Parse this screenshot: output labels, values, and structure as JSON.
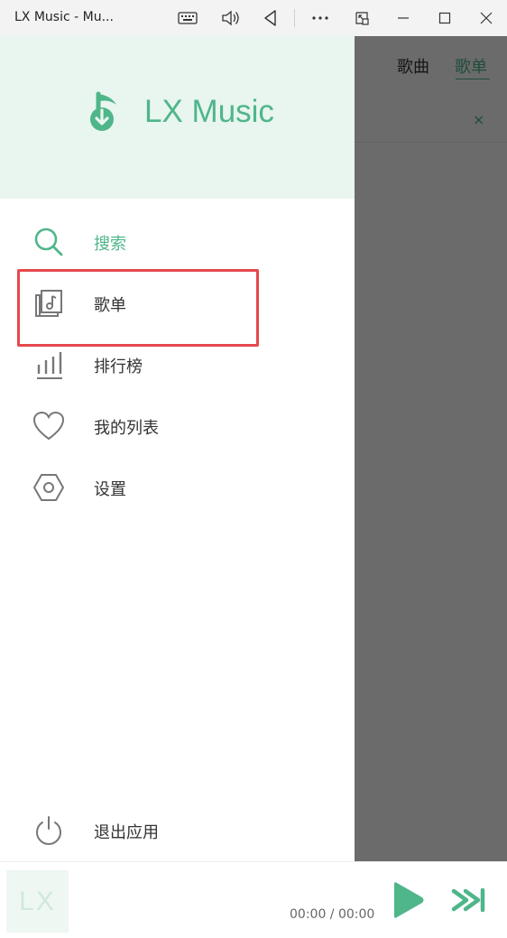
{
  "window": {
    "title": "LX Music - Mu...",
    "controls": [
      "keyboard-icon",
      "volume-icon",
      "back-icon",
      "more-icon",
      "compact-overlay-icon",
      "minimize-icon",
      "maximize-icon",
      "close-icon"
    ]
  },
  "background_app": {
    "tabs": [
      {
        "label": "歌曲"
      },
      {
        "label": "歌单"
      }
    ],
    "active_tab": "歌单",
    "close_label": "×"
  },
  "drawer": {
    "brand": "LX Music",
    "items": [
      {
        "label": "搜索",
        "icon": "search-icon",
        "active": true
      },
      {
        "label": "歌单",
        "icon": "playlist-icon",
        "active": false,
        "highlighted": true
      },
      {
        "label": "排行榜",
        "icon": "chart-bars-icon",
        "active": false
      },
      {
        "label": "我的列表",
        "icon": "heart-icon",
        "active": false
      },
      {
        "label": "设置",
        "icon": "hexagon-settings-icon",
        "active": false
      }
    ],
    "exit": {
      "label": "退出应用",
      "icon": "power-icon"
    }
  },
  "player": {
    "cover_text": "LX",
    "time_current": "00:00",
    "time_separator": " / ",
    "time_total": "00:00",
    "time_display": "00:00 / 00:00"
  },
  "colors": {
    "accent": "#4fb68a",
    "header_bg": "#e9f5ef",
    "highlight_border": "#e5484d",
    "overlay": "#6b6b6b"
  }
}
